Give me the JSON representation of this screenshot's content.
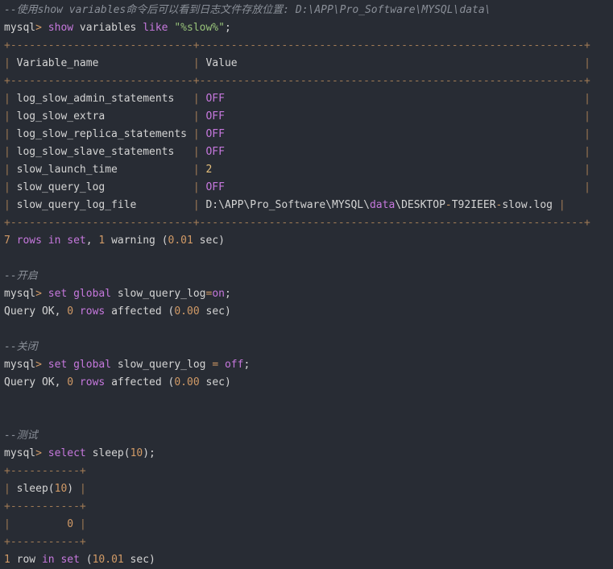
{
  "colors": {
    "background": "#282c34",
    "text": "#d4d4d4",
    "comment": "#8a8f98",
    "keyword": "#c678dd",
    "number": "#d19a66",
    "string": "#98c379",
    "border": "#a07a55",
    "yellow": "#e5c07b"
  },
  "lines": [
    {
      "name": "comment-show-variables",
      "tokens": [
        {
          "t": "--使用show variables命令后可以看到日志文件存放位置: D:\\APP\\Pro_Software\\MYSQL\\data\\",
          "c": "comment"
        }
      ]
    },
    {
      "name": "cmd-show-variables",
      "tokens": [
        {
          "t": "mysql",
          "c": "plain"
        },
        {
          "t": ">",
          "c": "op"
        },
        {
          "t": " ",
          "c": "plain"
        },
        {
          "t": "show",
          "c": "kw"
        },
        {
          "t": " variables ",
          "c": "plain"
        },
        {
          "t": "like",
          "c": "kw"
        },
        {
          "t": " ",
          "c": "plain"
        },
        {
          "t": "\"%slow%\"",
          "c": "str"
        },
        {
          "t": ";",
          "c": "plain"
        }
      ]
    },
    {
      "name": "table-border",
      "tokens": [
        {
          "t": "+-----------------------------+-------------------------------------------------------------+",
          "c": "border"
        }
      ]
    },
    {
      "name": "table-header-row",
      "tokens": [
        {
          "t": "| ",
          "c": "border"
        },
        {
          "t": "Variable_name               ",
          "c": "plain"
        },
        {
          "t": "| ",
          "c": "border"
        },
        {
          "t": "Value                                                       ",
          "c": "plain"
        },
        {
          "t": "|",
          "c": "border"
        }
      ]
    },
    {
      "name": "table-border",
      "tokens": [
        {
          "t": "+-----------------------------+-------------------------------------------------------------+",
          "c": "border"
        }
      ]
    },
    {
      "name": "table-row",
      "tokens": [
        {
          "t": "| ",
          "c": "border"
        },
        {
          "t": "log_slow_admin_statements   ",
          "c": "plain"
        },
        {
          "t": "| ",
          "c": "border"
        },
        {
          "t": "OFF",
          "c": "val-off"
        },
        {
          "t": "                                                         ",
          "c": "plain"
        },
        {
          "t": "|",
          "c": "border"
        }
      ]
    },
    {
      "name": "table-row",
      "tokens": [
        {
          "t": "| ",
          "c": "border"
        },
        {
          "t": "log_slow_extra              ",
          "c": "plain"
        },
        {
          "t": "| ",
          "c": "border"
        },
        {
          "t": "OFF",
          "c": "val-off"
        },
        {
          "t": "                                                         ",
          "c": "plain"
        },
        {
          "t": "|",
          "c": "border"
        }
      ]
    },
    {
      "name": "table-row",
      "tokens": [
        {
          "t": "| ",
          "c": "border"
        },
        {
          "t": "log_slow_replica_statements ",
          "c": "plain"
        },
        {
          "t": "| ",
          "c": "border"
        },
        {
          "t": "OFF",
          "c": "val-off"
        },
        {
          "t": "                                                         ",
          "c": "plain"
        },
        {
          "t": "|",
          "c": "border"
        }
      ]
    },
    {
      "name": "table-row",
      "tokens": [
        {
          "t": "| ",
          "c": "border"
        },
        {
          "t": "log_slow_slave_statements   ",
          "c": "plain"
        },
        {
          "t": "| ",
          "c": "border"
        },
        {
          "t": "OFF",
          "c": "val-off"
        },
        {
          "t": "                                                         ",
          "c": "plain"
        },
        {
          "t": "|",
          "c": "border"
        }
      ]
    },
    {
      "name": "table-row",
      "tokens": [
        {
          "t": "| ",
          "c": "border"
        },
        {
          "t": "slow_launch_time            ",
          "c": "plain"
        },
        {
          "t": "| ",
          "c": "border"
        },
        {
          "t": "2",
          "c": "val-num"
        },
        {
          "t": "                                                           ",
          "c": "plain"
        },
        {
          "t": "|",
          "c": "border"
        }
      ]
    },
    {
      "name": "table-row",
      "tokens": [
        {
          "t": "| ",
          "c": "border"
        },
        {
          "t": "slow_query_log              ",
          "c": "plain"
        },
        {
          "t": "| ",
          "c": "border"
        },
        {
          "t": "OFF",
          "c": "val-off"
        },
        {
          "t": "                                                         ",
          "c": "plain"
        },
        {
          "t": "|",
          "c": "border"
        }
      ]
    },
    {
      "name": "table-row",
      "tokens": [
        {
          "t": "| ",
          "c": "border"
        },
        {
          "t": "slow_query_log_file         ",
          "c": "plain"
        },
        {
          "t": "| ",
          "c": "border"
        },
        {
          "t": "D:\\APP\\Pro_Software\\MYSQL\\",
          "c": "plain"
        },
        {
          "t": "data",
          "c": "kw"
        },
        {
          "t": "\\DESKTOP",
          "c": "plain"
        },
        {
          "t": "-",
          "c": "op"
        },
        {
          "t": "T92IEER",
          "c": "plain"
        },
        {
          "t": "-",
          "c": "op"
        },
        {
          "t": "slow.log ",
          "c": "plain"
        },
        {
          "t": "|",
          "c": "border"
        }
      ]
    },
    {
      "name": "table-border",
      "tokens": [
        {
          "t": "+-----------------------------+-------------------------------------------------------------+",
          "c": "border"
        }
      ]
    },
    {
      "name": "result-summary",
      "tokens": [
        {
          "t": "7",
          "c": "num"
        },
        {
          "t": " rows ",
          "c": "kw"
        },
        {
          "t": "in",
          "c": "kw"
        },
        {
          "t": " ",
          "c": "plain"
        },
        {
          "t": "set",
          "c": "kw"
        },
        {
          "t": ", ",
          "c": "plain"
        },
        {
          "t": "1",
          "c": "num"
        },
        {
          "t": " warning ",
          "c": "plain"
        },
        {
          "t": "(",
          "c": "plain"
        },
        {
          "t": "0.01",
          "c": "num"
        },
        {
          "t": " sec)",
          "c": "plain"
        }
      ]
    },
    {
      "name": "blank-line",
      "tokens": [
        {
          "t": " ",
          "c": "plain"
        }
      ]
    },
    {
      "name": "comment-enable",
      "tokens": [
        {
          "t": "--开启",
          "c": "comment"
        }
      ]
    },
    {
      "name": "cmd-enable-slow-log",
      "tokens": [
        {
          "t": "mysql",
          "c": "plain"
        },
        {
          "t": ">",
          "c": "op"
        },
        {
          "t": " ",
          "c": "plain"
        },
        {
          "t": "set",
          "c": "kw"
        },
        {
          "t": " ",
          "c": "plain"
        },
        {
          "t": "global",
          "c": "kw"
        },
        {
          "t": " slow_query_log",
          "c": "plain"
        },
        {
          "t": "=",
          "c": "op"
        },
        {
          "t": "on",
          "c": "kw"
        },
        {
          "t": ";",
          "c": "plain"
        }
      ]
    },
    {
      "name": "query-ok-line",
      "tokens": [
        {
          "t": "Query OK, ",
          "c": "plain"
        },
        {
          "t": "0",
          "c": "num"
        },
        {
          "t": " rows ",
          "c": "kw"
        },
        {
          "t": "affected ",
          "c": "plain"
        },
        {
          "t": "(",
          "c": "plain"
        },
        {
          "t": "0.00",
          "c": "num"
        },
        {
          "t": " sec)",
          "c": "plain"
        }
      ]
    },
    {
      "name": "blank-line",
      "tokens": [
        {
          "t": " ",
          "c": "plain"
        }
      ]
    },
    {
      "name": "comment-disable",
      "tokens": [
        {
          "t": "--关闭",
          "c": "comment"
        }
      ]
    },
    {
      "name": "cmd-disable-slow-log",
      "tokens": [
        {
          "t": "mysql",
          "c": "plain"
        },
        {
          "t": ">",
          "c": "op"
        },
        {
          "t": " ",
          "c": "plain"
        },
        {
          "t": "set",
          "c": "kw"
        },
        {
          "t": " ",
          "c": "plain"
        },
        {
          "t": "global",
          "c": "kw"
        },
        {
          "t": " slow_query_log ",
          "c": "plain"
        },
        {
          "t": "=",
          "c": "op"
        },
        {
          "t": " ",
          "c": "plain"
        },
        {
          "t": "off",
          "c": "kw"
        },
        {
          "t": ";",
          "c": "plain"
        }
      ]
    },
    {
      "name": "query-ok-line",
      "tokens": [
        {
          "t": "Query OK, ",
          "c": "plain"
        },
        {
          "t": "0",
          "c": "num"
        },
        {
          "t": " rows ",
          "c": "kw"
        },
        {
          "t": "affected ",
          "c": "plain"
        },
        {
          "t": "(",
          "c": "plain"
        },
        {
          "t": "0.00",
          "c": "num"
        },
        {
          "t": " sec)",
          "c": "plain"
        }
      ]
    },
    {
      "name": "blank-line",
      "tokens": [
        {
          "t": " ",
          "c": "plain"
        }
      ]
    },
    {
      "name": "blank-line",
      "tokens": [
        {
          "t": " ",
          "c": "plain"
        }
      ]
    },
    {
      "name": "comment-test",
      "tokens": [
        {
          "t": "--测试",
          "c": "comment"
        }
      ]
    },
    {
      "name": "cmd-select-sleep",
      "tokens": [
        {
          "t": "mysql",
          "c": "plain"
        },
        {
          "t": ">",
          "c": "op"
        },
        {
          "t": " ",
          "c": "plain"
        },
        {
          "t": "select",
          "c": "kw"
        },
        {
          "t": " sleep(",
          "c": "plain"
        },
        {
          "t": "10",
          "c": "num"
        },
        {
          "t": ");",
          "c": "plain"
        }
      ]
    },
    {
      "name": "table-border",
      "tokens": [
        {
          "t": "+-----------+",
          "c": "border"
        }
      ]
    },
    {
      "name": "table-header-row",
      "tokens": [
        {
          "t": "| ",
          "c": "border"
        },
        {
          "t": "sleep(",
          "c": "plain"
        },
        {
          "t": "10",
          "c": "num"
        },
        {
          "t": ") ",
          "c": "plain"
        },
        {
          "t": "|",
          "c": "border"
        }
      ]
    },
    {
      "name": "table-border",
      "tokens": [
        {
          "t": "+-----------+",
          "c": "border"
        }
      ]
    },
    {
      "name": "table-row",
      "tokens": [
        {
          "t": "|",
          "c": "border"
        },
        {
          "t": "         ",
          "c": "plain"
        },
        {
          "t": "0",
          "c": "num"
        },
        {
          "t": " ",
          "c": "plain"
        },
        {
          "t": "|",
          "c": "border"
        }
      ]
    },
    {
      "name": "table-border",
      "tokens": [
        {
          "t": "+-----------+",
          "c": "border"
        }
      ]
    },
    {
      "name": "result-summary",
      "tokens": [
        {
          "t": "1",
          "c": "num"
        },
        {
          "t": " row ",
          "c": "plain"
        },
        {
          "t": "in",
          "c": "kw"
        },
        {
          "t": " ",
          "c": "plain"
        },
        {
          "t": "set",
          "c": "kw"
        },
        {
          "t": " (",
          "c": "plain"
        },
        {
          "t": "10.01",
          "c": "num"
        },
        {
          "t": " sec)",
          "c": "plain"
        }
      ]
    }
  ]
}
